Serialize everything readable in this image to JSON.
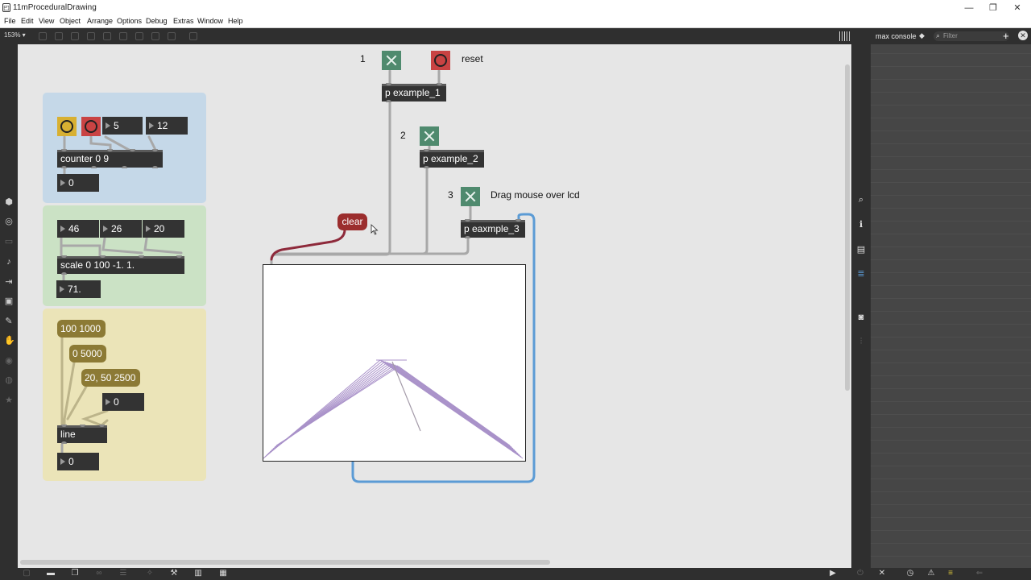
{
  "window": {
    "title": "11mProceduralDrawing",
    "controls": [
      "—",
      "❐",
      "✕"
    ]
  },
  "menu": [
    "File",
    "Edit",
    "View",
    "Object",
    "Arrange",
    "Options",
    "Debug",
    "Extras",
    "Window",
    "Help"
  ],
  "toolbar": {
    "zoom": "153% ▾"
  },
  "console": {
    "title": "max console",
    "filter_placeholder": "Filter",
    "add": "+",
    "close": "✕"
  },
  "patcher": {
    "labels": {
      "one": "1",
      "two": "2",
      "three": "3",
      "reset": "reset",
      "drag_hint": "Drag mouse over lcd"
    },
    "objects": {
      "example_1": "p example_1",
      "example_2": "p example_2",
      "example_3": "p eaxmple_3",
      "counter": "counter 0 9",
      "scale": "scale 0 100 -1. 1.",
      "line": "line"
    },
    "numbers": {
      "counter_min": "5",
      "counter_max": "12",
      "counter_out": "0",
      "scale_in": "46",
      "scale_a": "26",
      "scale_b": "20",
      "scale_out": "71.",
      "line_in": "0",
      "line_out": "0"
    },
    "messages": {
      "m1": "100 1000",
      "m2": "0 5000",
      "m3": "20, 50 2500",
      "clear": "clear"
    }
  },
  "colors": {
    "toggle": "#4f8a6e",
    "bang_red": "#c94343",
    "bang_yellow": "#d8b032",
    "lcd_stroke": "#9b7fc0",
    "wire_blue": "#5b9bd5",
    "wire_red": "#8e2a3b"
  }
}
